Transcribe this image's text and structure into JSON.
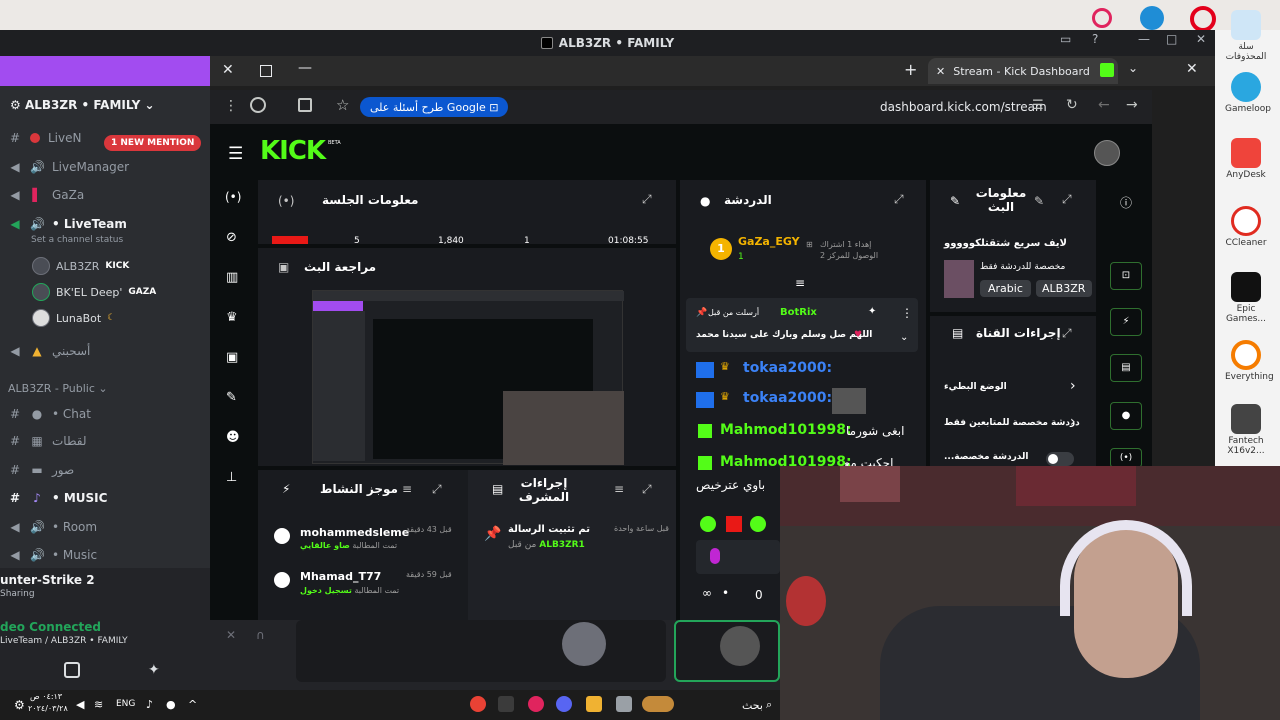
{
  "discord": {
    "window_title": "ALB3ZR • FAMILY",
    "server_name": "ALB3ZR • FAMILY",
    "mention_badge": "1 NEW MENTION",
    "channels": [
      {
        "type": "text",
        "label": "LiveN",
        "icon": "hash-icon"
      },
      {
        "type": "voice",
        "label": "LiveManager",
        "icon": "speaker-icon"
      },
      {
        "type": "voice",
        "label": "GaZa",
        "icon": "speaker-icon"
      },
      {
        "type": "voice",
        "label": "• LiveTeam",
        "icon": "speaker-icon"
      }
    ],
    "channel_status": "Set a channel status",
    "voice_users": [
      {
        "name": "ALB3ZR",
        "tag": "KICK"
      },
      {
        "name": "BK'EL Deep'",
        "tag": "GAZA"
      },
      {
        "name": "LunaBot",
        "tag": ""
      }
    ],
    "voice_channel_2": "أسحبني",
    "category": "ALB3ZR - Public",
    "channels_2": [
      {
        "label": "• Chat",
        "icon": "hash-icon"
      },
      {
        "label": "لقطات",
        "icon": "hash-icon"
      },
      {
        "label": "صور",
        "icon": "hash-icon"
      },
      {
        "label": "• MUSIC",
        "icon": "hash-icon"
      },
      {
        "label": "• Room",
        "icon": "speaker-icon"
      },
      {
        "label": "• Music",
        "icon": "speaker-icon"
      }
    ],
    "activity_game": "unter-Strike 2",
    "activity_status": "Sharing",
    "voice_connected": "deo Connected",
    "voice_path": "LiveTeam / ALB3ZR • FAMILY"
  },
  "browser": {
    "tab_title": "Stream - Kick Dashboard",
    "search_chip": "طرح أسئلة على Google",
    "url": "dashboard.kick.com/stream"
  },
  "kick": {
    "logo": "KICK",
    "beta": "BETA",
    "session_info": "معلومات الجلسة",
    "session_stats": [
      "5",
      "1,840",
      "1",
      "01:08:55"
    ],
    "stream_review": "مراجعة البث",
    "chat_title": "الدردشة",
    "stream_info_title": "معلومات البث",
    "stream_title": "لايف سريع شتقتلكووووو",
    "stream_category": "مخصصة للدردشة فقط",
    "tags": [
      "Arabic",
      "ALB3ZR"
    ],
    "channel_actions": "إجراءات القناة",
    "slow_mode": "الوضع البطيء",
    "followers_only": "دردشة مخصصة للمتابعين فقط",
    "subscribers_only": "...الدردشة مخصصة",
    "top_sub": {
      "rank": "1",
      "name": "GaZa_EGY",
      "count": "1",
      "subtitle": "إهداء 1 اشتراك",
      "subtitle2": "الوصول للمركز 2"
    },
    "pinned": {
      "by": "أرسلت من قبل",
      "bot": "BotRix",
      "text": "اللهم صل وسلم وبارك على سيدنا محمد"
    },
    "messages": [
      {
        "user": "tokaa2000:",
        "text": ""
      },
      {
        "user": "tokaa2000:",
        "text": ""
      },
      {
        "user": "Mahmod101998:",
        "text": "ابغى شورما"
      },
      {
        "user": "Mahmod101998:",
        "text": "احكيت مع"
      }
    ],
    "partial_msg": "باوي عترخيص",
    "activity_feed": "موجز النشاط",
    "activities": [
      {
        "user": "mohammedsleme",
        "action": "تمت المطالبة",
        "reward": "صاو عالقايي",
        "time": "قبل 43 دقيقة"
      },
      {
        "user": "Mhamad_T77",
        "action": "تمت المطالبة",
        "reward": "تسجيل دخول",
        "time": "قبل 59 دقيقة"
      }
    ],
    "mod_actions": "إجراءات المشرف",
    "mod_item": {
      "title": "تم تثبيت الرسالة",
      "by": "من قبل",
      "user": "ALB3ZR1",
      "time": "قبل ساعة واحدة"
    },
    "chat_count": "0",
    "colors": {
      "accent": "#53fc18",
      "bg": "#0b0e0f",
      "card": "#191b1f"
    }
  },
  "taskbar": {
    "lang": "ENG",
    "time": "٠٤:١٣ ص",
    "date": "٢٠٢٤/٠٣/٢٨",
    "search": "بحث"
  },
  "desktop": {
    "icons": [
      {
        "label": "سلة المحذوفات"
      },
      {
        "label": "Gameloop"
      },
      {
        "label": "AnyDesk"
      },
      {
        "label": "CCleaner"
      },
      {
        "label": "Epic Games..."
      },
      {
        "label": "Everything"
      },
      {
        "label": "Fantech X16v2..."
      }
    ]
  }
}
